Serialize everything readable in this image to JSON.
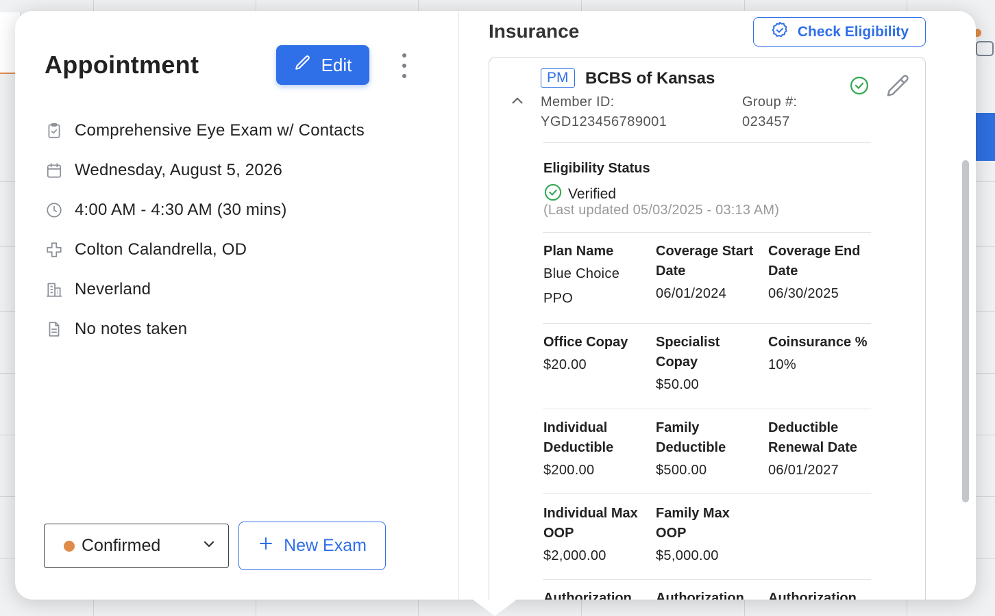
{
  "appointment": {
    "title": "Appointment",
    "edit_label": "Edit",
    "details": [
      {
        "icon": "clipboard-icon",
        "text": "Comprehensive Eye Exam w/ Contacts"
      },
      {
        "icon": "calendar-icon",
        "text": "Wednesday, August 5, 2026"
      },
      {
        "icon": "clock-icon",
        "text": "4:00 AM - 4:30 AM (30 mins)"
      },
      {
        "icon": "medical-cross-icon",
        "text": "Colton Calandrella, OD"
      },
      {
        "icon": "building-icon",
        "text": "Neverland"
      },
      {
        "icon": "document-icon",
        "text": "No notes taken"
      }
    ],
    "status_label": "Confirmed",
    "status_color": "#e08b4a",
    "new_exam_label": "New Exam"
  },
  "insurance": {
    "title": "Insurance",
    "check_eligibility_label": "Check Eligibility",
    "badge": "PM",
    "payer": "BCBS of Kansas",
    "member_id_label": "Member ID:",
    "member_id": "YGD123456789001",
    "group_label": "Group #:",
    "group": "023457",
    "eligibility_title": "Eligibility Status",
    "eligibility_status": "Verified",
    "eligibility_updated": "(Last updated 05/03/2025 - 03:13 AM)",
    "rows": [
      [
        {
          "label": "Plan Name",
          "value": "Blue Choice PPO"
        },
        {
          "label": "Coverage Start Date",
          "value": "06/01/2024"
        },
        {
          "label": "Coverage End Date",
          "value": "06/30/2025"
        }
      ],
      [
        {
          "label": "Office Copay",
          "value": "$20.00"
        },
        {
          "label": "Specialist Copay",
          "value": "$50.00"
        },
        {
          "label": "Coinsurance %",
          "value": "10%"
        }
      ],
      [
        {
          "label": "Individual Deductible",
          "value": "$200.00"
        },
        {
          "label": "Family Deductible",
          "value": "$500.00"
        },
        {
          "label": "Deductible Renewal Date",
          "value": "06/01/2027"
        }
      ],
      [
        {
          "label": "Individual Max OOP",
          "value": "$2,000.00"
        },
        {
          "label": "Family Max OOP",
          "value": "$5,000.00"
        }
      ],
      [
        {
          "label": "Authorization",
          "value": ""
        },
        {
          "label": "Authorization",
          "value": ""
        },
        {
          "label": "Authorization",
          "value": ""
        }
      ]
    ]
  },
  "colors": {
    "accent": "#2f6fe8",
    "success": "#34a853"
  }
}
